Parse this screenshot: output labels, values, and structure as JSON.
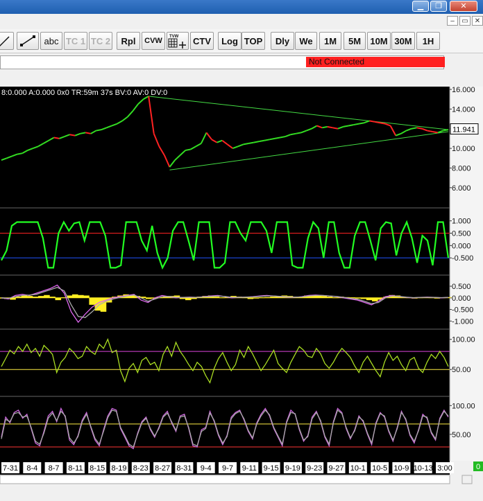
{
  "window": {
    "title": "",
    "controls": [
      "▁",
      "❐",
      "✕"
    ],
    "mdi_controls": [
      "–",
      "▭",
      "✕"
    ]
  },
  "toolbar": {
    "buttons": [
      {
        "name": "line-tool",
        "label": "",
        "icon": "line-icon"
      },
      {
        "name": "segment-tool",
        "label": "",
        "icon": "segment-icon"
      },
      {
        "name": "abc-tool",
        "label": "abc"
      },
      {
        "name": "tc1-button",
        "label": "TC 1"
      },
      {
        "name": "tc2-button",
        "label": "TC 2"
      },
      {
        "name": "rpl-button",
        "label": "Rpl"
      },
      {
        "name": "cvw-button",
        "label": "CVW"
      },
      {
        "name": "tvw-button",
        "label": "TVW",
        "icon": "grid-plus-icon"
      },
      {
        "name": "ctv-button",
        "label": "CTV"
      },
      {
        "name": "log-button",
        "label": "Log"
      },
      {
        "name": "top-button",
        "label": "TOP"
      },
      {
        "name": "dly-button",
        "label": "Dly"
      },
      {
        "name": "we-button",
        "label": "We"
      },
      {
        "name": "1m-button",
        "label": "1M"
      },
      {
        "name": "5m-button",
        "label": "5M"
      },
      {
        "name": "10m-button",
        "label": "10M"
      },
      {
        "name": "30m-button",
        "label": "30M"
      },
      {
        "name": "1h-button",
        "label": "1H"
      }
    ]
  },
  "status": {
    "connection": "Not Connected",
    "connection_color": "#ff2020"
  },
  "chart_data": {
    "type": "line",
    "info_line": "8:0.000 A:0.000 0x0 TR:59m 37s BV:0 AV:0 DV:0",
    "last_price": "11.941",
    "x_tick_labels": [
      "7-31",
      "8-4",
      "8-7",
      "8-11",
      "8-15",
      "8-19",
      "8-23",
      "8-27",
      "8-31",
      "9-4",
      "9-7",
      "9-11",
      "9-15",
      "9-19",
      "9-23",
      "9-27",
      "10-1",
      "10-5",
      "10-9",
      "10-13",
      "3:00"
    ],
    "bottom_right_badge": "0",
    "panels": [
      {
        "name": "price",
        "y_tick_labels": [
          "16.000",
          "14.000",
          "12.000",
          "10.000",
          "8.000",
          "6.000"
        ],
        "ylim": [
          5,
          16
        ],
        "series": [
          {
            "values": [
              8.8,
              9.0,
              9.2,
              9.4,
              9.5,
              9.8,
              10.0,
              10.2,
              10.5,
              10.8,
              11.1,
              11.0,
              11.2,
              11.4,
              11.3,
              11.5,
              11.6,
              11.5,
              11.8,
              11.9,
              12.1,
              12.3,
              12.5,
              12.8,
              13.2,
              13.8,
              14.5,
              15.0,
              15.3,
              11.5,
              10.2,
              9.3,
              8.1,
              8.8,
              9.3,
              9.8,
              9.9,
              10.2,
              10.5,
              11.6,
              10.9,
              10.6,
              10.8,
              10.4,
              10.0,
              10.2,
              10.4,
              10.5,
              10.6,
              10.7,
              10.8,
              10.9,
              11.0,
              11.1,
              11.2,
              11.4,
              11.5,
              11.6,
              11.8,
              12.0,
              12.3,
              12.1,
              12.2,
              12.1,
              12.0,
              12.2,
              12.3,
              12.4,
              12.5,
              12.6,
              12.8,
              12.7,
              12.6,
              12.5,
              12.3,
              11.3,
              11.5,
              11.8,
              12.0,
              12.1,
              12.0,
              11.8,
              11.7,
              11.6,
              11.8,
              11.9
            ],
            "color_up": "#33dd22",
            "color_down": "#ff2222"
          }
        ],
        "trendlines": [
          {
            "from": [
              28,
              15.3
            ],
            "to": [
              85,
              11.9
            ],
            "color": "#44dd44"
          },
          {
            "from": [
              32,
              7.8
            ],
            "to": [
              85,
              11.7
            ],
            "color": "#44dd44"
          }
        ]
      },
      {
        "name": "oscillator-1",
        "y_tick_labels": [
          "1.000",
          "0.500",
          "0.000",
          "-0.500"
        ],
        "ylim": [
          -1.0,
          1.3
        ],
        "levels": [
          {
            "value": 0.5,
            "color": "#ff2222"
          },
          {
            "value": -0.5,
            "color": "#2255ff"
          }
        ],
        "series": [
          {
            "values": [
              -0.6,
              -0.2,
              0.8,
              0.95,
              0.95,
              0.95,
              0.95,
              0.95,
              0.3,
              -0.9,
              -0.9,
              0.5,
              0.95,
              0.6,
              0.9,
              0.95,
              0.2,
              0.95,
              0.95,
              0.95,
              0.4,
              -0.9,
              -0.9,
              -0.8,
              0.95,
              0.95,
              0.95,
              0.2,
              -0.2,
              0.8,
              -0.3,
              -0.9,
              -0.5,
              0.6,
              0.95,
              0.95,
              0.2,
              -0.6,
              0.95,
              0.95,
              0.95,
              -0.9,
              -0.9,
              -0.7,
              0.95,
              0.95,
              0.5,
              0.2,
              0.95,
              0.95,
              0.95,
              0.6,
              -0.3,
              0.95,
              0.95,
              0.95,
              -0.8,
              -0.9,
              -0.9,
              0.3,
              0.95,
              0.7,
              -0.5,
              0.95,
              0.95,
              -0.3,
              -0.9,
              -0.9,
              0.4,
              0.95,
              0.95,
              0.2,
              -0.6,
              0.7,
              0.95,
              0.9,
              -0.4,
              0.5,
              0.95,
              0.3,
              -0.7,
              0.4,
              0.2,
              -0.8,
              0.95,
              0.95,
              -0.5
            ],
            "color": "#22ff22"
          }
        ]
      },
      {
        "name": "oscillator-2",
        "y_tick_labels": [
          "0.500",
          "0.000",
          "-0.500",
          "-1.000"
        ],
        "ylim": [
          -1.2,
          0.8
        ],
        "series": [
          {
            "name": "histogram",
            "values": [
              0.0,
              -0.05,
              -0.08,
              0.05,
              0.1,
              0.08,
              0.05,
              0.08,
              0.12,
              0.05,
              -0.1,
              0.02,
              0.1,
              0.15,
              0.12,
              0.1,
              -0.3,
              -0.55,
              -0.6,
              -0.2,
              0.05,
              0.1,
              0.15,
              0.12,
              0.08,
              0.05,
              -0.05,
              -0.02,
              0.02,
              0.05,
              0.08,
              0.1,
              -0.05,
              -0.1,
              -0.05,
              0.05,
              0.08,
              0.1,
              0.05,
              0.02,
              0.05,
              0.08,
              0.05,
              0.02,
              -0.05,
              -0.02,
              0.02,
              0.03,
              0.05,
              0.08,
              0.1,
              0.08,
              0.05,
              0.05,
              0.1,
              0.12,
              0.1,
              0.08,
              0.05,
              0.02,
              0.05,
              0.03,
              0.02,
              -0.02,
              -0.05,
              -0.1,
              -0.15,
              -0.08,
              0.05,
              0.12,
              0.1,
              0.05,
              0.02,
              0.0,
              0.02,
              0.03,
              0.02,
              0.0,
              0.02,
              0.03
            ],
            "color": "#ffee22"
          },
          {
            "name": "line-a",
            "values": [
              0.0,
              -0.05,
              0.1,
              0.15,
              0.1,
              0.2,
              0.3,
              0.4,
              0.55,
              0.2,
              -0.6,
              -1.05,
              -0.7,
              -0.4,
              -0.2,
              -0.1,
              0.0,
              0.05,
              0.1,
              0.15,
              -0.1,
              -0.2,
              0.0,
              0.1,
              0.05,
              0.0,
              0.02,
              0.03,
              0.02,
              0.05,
              0.08,
              0.1,
              0.05,
              0.0,
              0.02,
              0.03,
              0.05,
              0.08,
              0.1,
              0.08,
              0.05,
              0.03,
              0.02,
              0.05,
              0.1,
              0.12,
              0.1,
              0.08,
              0.05,
              0.0,
              -0.05,
              -0.1,
              -0.2,
              -0.3,
              -0.15,
              0.05,
              0.1,
              0.05,
              0.02,
              0.0,
              0.02,
              0.03,
              0.02,
              0.0,
              0.02
            ],
            "color": "#dd66ee"
          },
          {
            "name": "line-b",
            "values": [
              0.0,
              -0.02,
              0.05,
              0.1,
              0.12,
              0.15,
              0.25,
              0.35,
              0.45,
              0.3,
              -0.3,
              -0.8,
              -0.85,
              -0.6,
              -0.3,
              -0.15,
              -0.05,
              0.02,
              0.08,
              0.12,
              0.0,
              -0.15,
              -0.05,
              0.05,
              0.06,
              0.02,
              0.02,
              0.02,
              0.02,
              0.04,
              0.06,
              0.08,
              0.06,
              0.02,
              0.02,
              0.03,
              0.04,
              0.06,
              0.08,
              0.08,
              0.06,
              0.04,
              0.03,
              0.04,
              0.08,
              0.1,
              0.1,
              0.08,
              0.06,
              0.02,
              -0.02,
              -0.06,
              -0.15,
              -0.25,
              -0.2,
              0.0,
              0.08,
              0.06,
              0.03,
              0.01,
              0.02,
              0.02,
              0.02,
              0.01,
              0.02
            ],
            "color": "#aaaaaa"
          }
        ]
      },
      {
        "name": "oscillator-3",
        "y_tick_labels": [
          "100.00",
          "50.00"
        ],
        "ylim": [
          10,
          110
        ],
        "levels": [
          {
            "value": 80,
            "color": "#dd44dd"
          },
          {
            "value": 50,
            "color": "#ffee44"
          }
        ],
        "series": [
          {
            "values": [
              55,
              68,
              82,
              76,
              88,
              80,
              92,
              78,
              85,
              72,
              90,
              83,
              75,
              45,
              62,
              70,
              85,
              78,
              68,
              72,
              88,
              80,
              75,
              92,
              85,
              100,
              78,
              82,
              48,
              30,
              52,
              60,
              45,
              65,
              70,
              58,
              62,
              48,
              75,
              88,
              72,
              95,
              80,
              70,
              58,
              48,
              62,
              55,
              40,
              28,
              52,
              68,
              78,
              62,
              48,
              58,
              82,
              70,
              88,
              76,
              62,
              48,
              58,
              70,
              82,
              60,
              52,
              45,
              62,
              75,
              88,
              82,
              72,
              70,
              85,
              76,
              60,
              52,
              62,
              75,
              85,
              78,
              70,
              56,
              45,
              62,
              72,
              60,
              48,
              38,
              62,
              78,
              65,
              72,
              58,
              48,
              66,
              70,
              52,
              45,
              62,
              75,
              68,
              80,
              70,
              55
            ],
            "color": "#aadd22"
          }
        ]
      },
      {
        "name": "oscillator-4",
        "y_tick_labels": [
          "100.00",
          "50.00"
        ],
        "ylim": [
          10,
          110
        ],
        "levels": [
          {
            "value": 68,
            "color": "#ffee44"
          },
          {
            "value": 28,
            "color": "#ff3333"
          }
        ],
        "series": [
          {
            "values": [
              45,
              80,
              70,
              88,
              92,
              78,
              85,
              60,
              35,
              30,
              55,
              82,
              90,
              72,
              95,
              80,
              40,
              32,
              48,
              75,
              88,
              62,
              40,
              30,
              58,
              82,
              95,
              92,
              60,
              45,
              30,
              25,
              52,
              72,
              80,
              58,
              45,
              62,
              82,
              90,
              70,
              55,
              82,
              85,
              60,
              30,
              28,
              58,
              62,
              90,
              72,
              48,
              32,
              48,
              80,
              88,
              92,
              75,
              55,
              42,
              70,
              85,
              95,
              82,
              60,
              45,
              30,
              72,
              92,
              85,
              58,
              38,
              48,
              80,
              90,
              72,
              45,
              30,
              72,
              95,
              88,
              60,
              42,
              58,
              82,
              72,
              50,
              32,
              70,
              88,
              80,
              55,
              38,
              62,
              90,
              75,
              48,
              35,
              58,
              85,
              78,
              52,
              40,
              78,
              92,
              80
            ],
            "color": "#cc66dd"
          },
          {
            "values": [
              42,
              76,
              72,
              86,
              88,
              80,
              82,
              62,
              38,
              33,
              52,
              78,
              87,
              74,
              90,
              82,
              44,
              35,
              46,
              72,
              85,
              64,
              43,
              33,
              55,
              79,
              92,
              90,
              62,
              48,
              33,
              28,
              50,
              70,
              78,
              60,
              47,
              60,
              80,
              87,
              72,
              57,
              80,
              82,
              62,
              33,
              30,
              55,
              60,
              87,
              74,
              50,
              35,
              46,
              77,
              86,
              90,
              77,
              57,
              44,
              68,
              82,
              92,
              84,
              62,
              47,
              33,
              70,
              88,
              86,
              60,
              40,
              46,
              77,
              88,
              74,
              47,
              33,
              70,
              92,
              86,
              62,
              44,
              56,
              80,
              74,
              52,
              35,
              68,
              86,
              82,
              57,
              40,
              60,
              88,
              77,
              50,
              38,
              56,
              82,
              80,
              54,
              42,
              76,
              90,
              82
            ],
            "color": "#aaaaaa"
          }
        ]
      }
    ]
  }
}
